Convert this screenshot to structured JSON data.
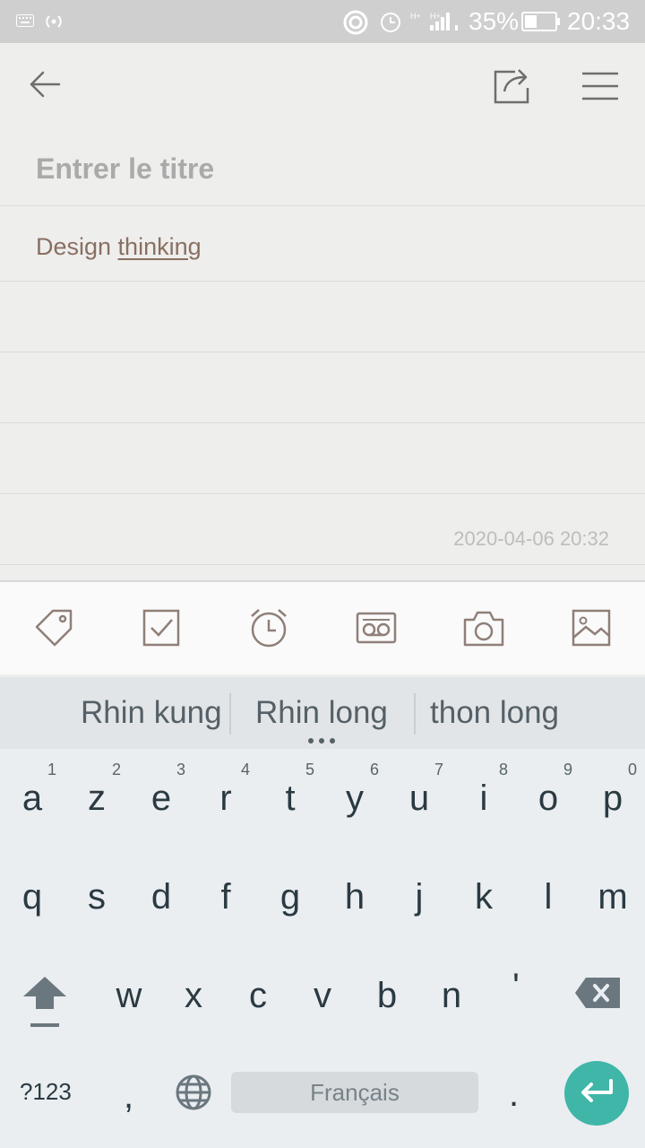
{
  "status_bar": {
    "battery": "35%",
    "time": "20:33"
  },
  "app_bar": {
    "back": "arrow-left-icon",
    "share": "share-icon",
    "menu": "menu-icon"
  },
  "note": {
    "title_placeholder": "Entrer le titre",
    "body_word1": "Design ",
    "body_word2": "thinking",
    "timestamp": "2020-04-06 20:32"
  },
  "toolbar": [
    "tag-icon",
    "checkbox-icon",
    "alarm-icon",
    "voicemail-icon",
    "camera-icon",
    "image-icon"
  ],
  "keyboard": {
    "suggestions": [
      "Rhin kung",
      "Rhin long",
      "thon long"
    ],
    "row1": [
      "a",
      "z",
      "e",
      "r",
      "t",
      "y",
      "u",
      "i",
      "o",
      "p"
    ],
    "row1_nums": [
      "1",
      "2",
      "3",
      "4",
      "5",
      "6",
      "7",
      "8",
      "9",
      "0"
    ],
    "row2": [
      "q",
      "s",
      "d",
      "f",
      "g",
      "h",
      "j",
      "k",
      "l",
      "m"
    ],
    "row3": [
      "w",
      "x",
      "c",
      "v",
      "b",
      "n",
      "'"
    ],
    "sym": "?123",
    "comma": ",",
    "space": "Français",
    "period": "."
  },
  "colors": {
    "accent": "#3fb6a8",
    "note_text": "#8a6f62",
    "icon": "#8f7f78"
  }
}
